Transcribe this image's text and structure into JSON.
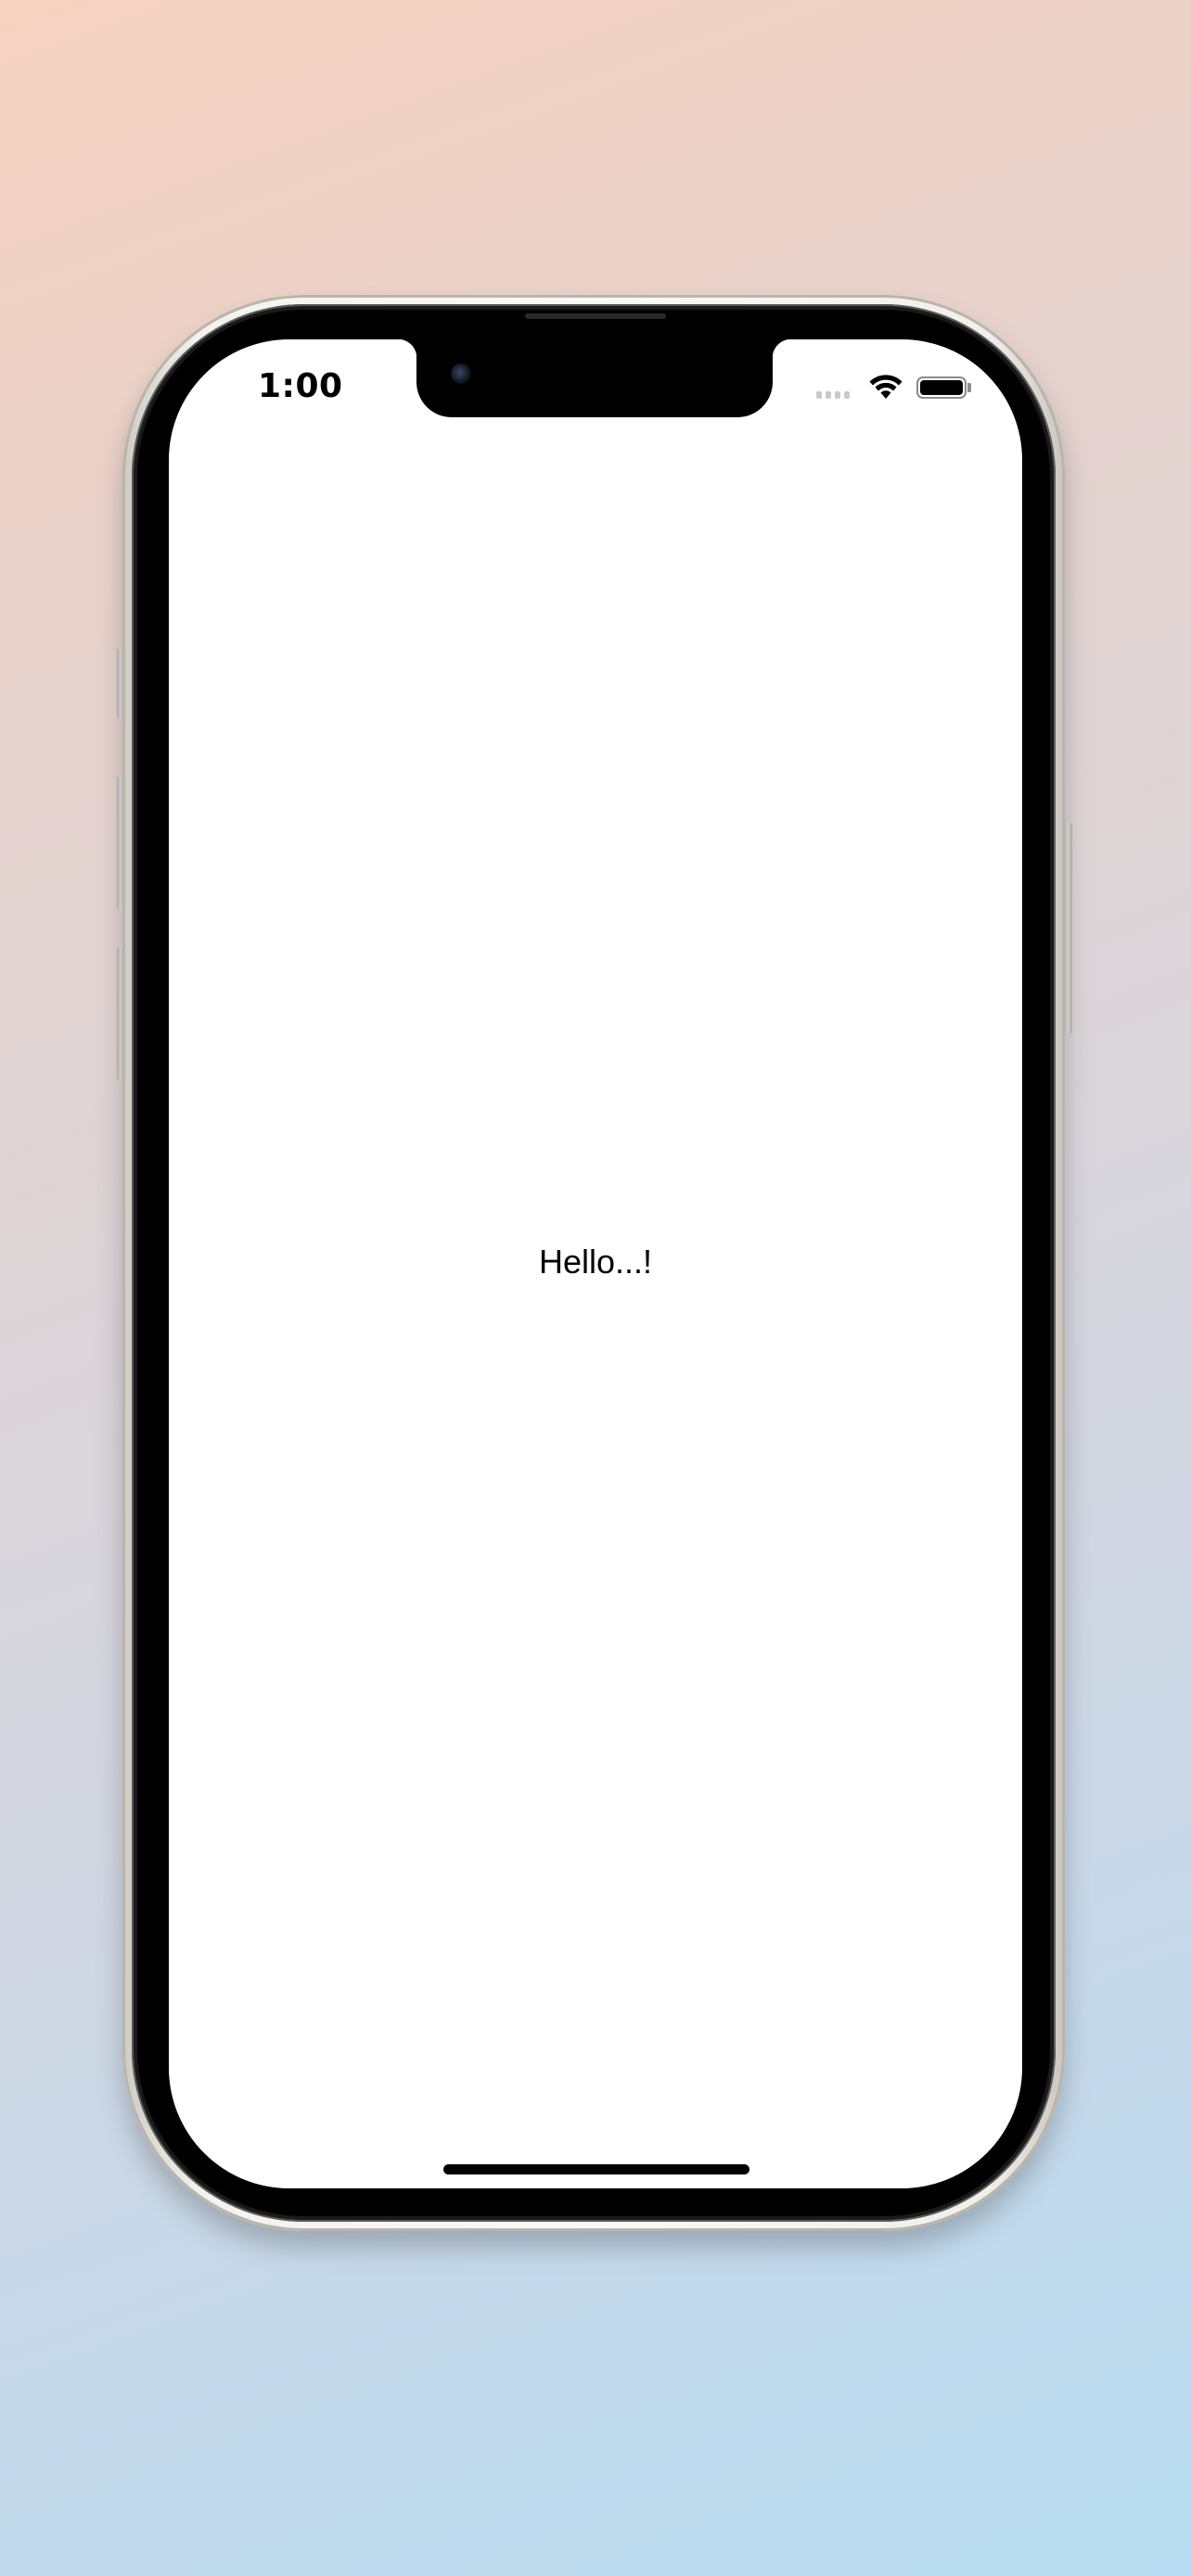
{
  "device": {
    "frame_color": "#f4f2ee",
    "screen_background": "#ffffff"
  },
  "status_bar": {
    "time": "1:00",
    "icons": [
      "signal-icon",
      "wifi-icon",
      "battery-icon"
    ]
  },
  "content": {
    "text": "Hello...!"
  }
}
